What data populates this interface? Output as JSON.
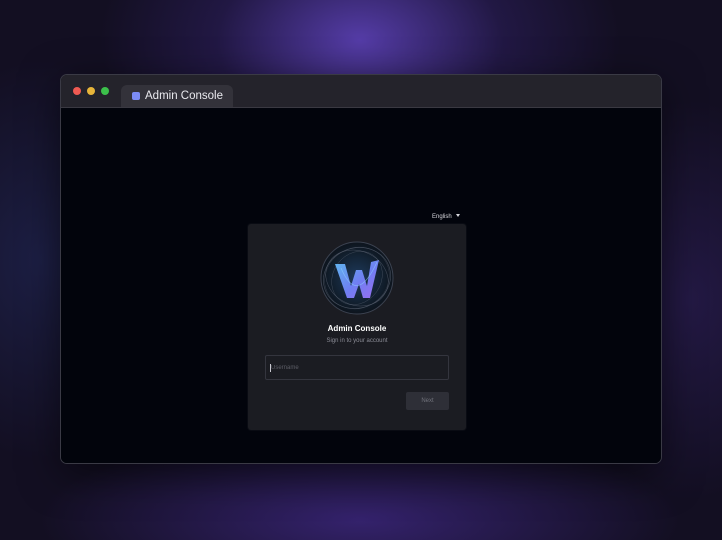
{
  "window": {
    "tab_title": "Admin Console",
    "tab_icon": "app-square-icon"
  },
  "login": {
    "language": "English",
    "logo_icon": "w-logo-icon",
    "title": "Admin Console",
    "subtitle": "Sign in to your account",
    "username_placeholder": "Username",
    "next_label": "Next"
  },
  "colors": {
    "accent": "#7c8cf5",
    "card_background": "#1b1c22",
    "page_background": "#02040c"
  }
}
